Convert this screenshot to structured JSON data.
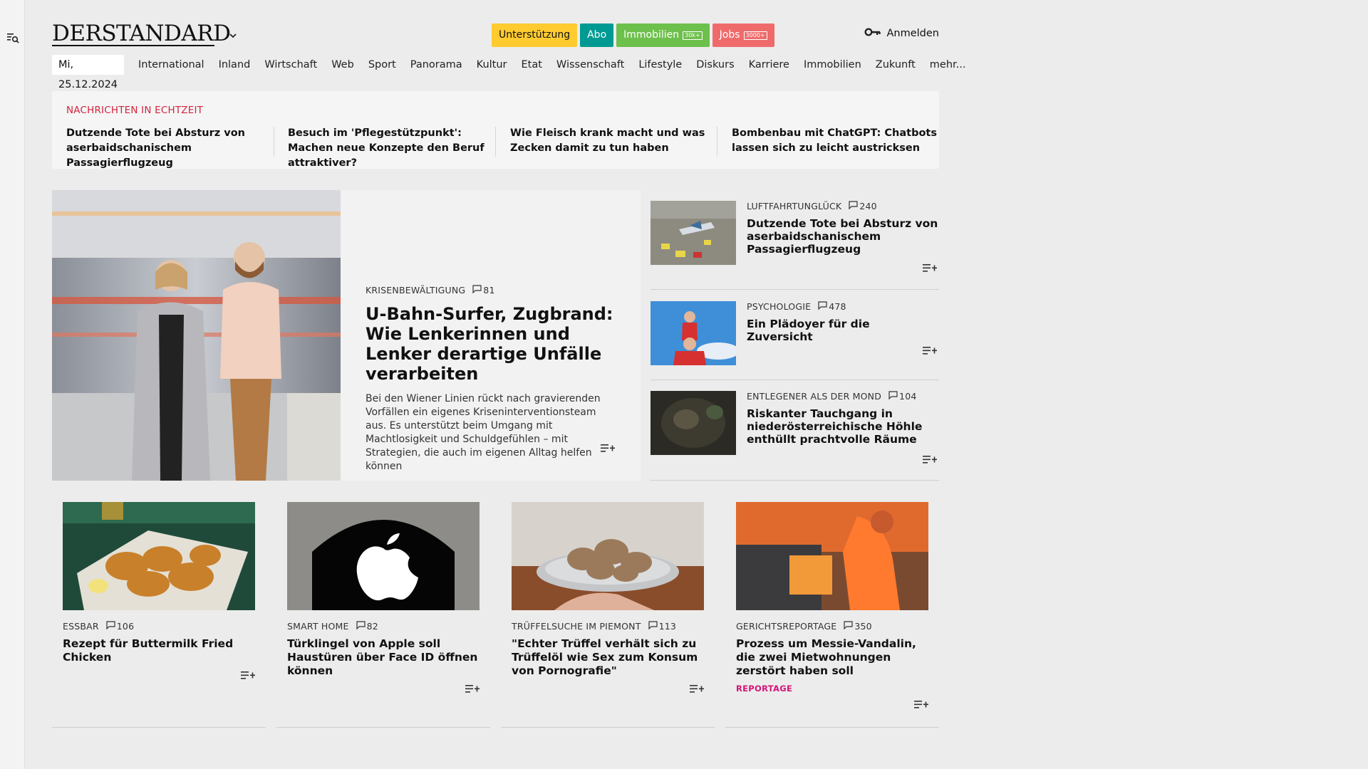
{
  "header": {
    "logo": "DERSTANDARD",
    "pills": [
      {
        "label": "Unterstützung",
        "bg": "#ffcb2f",
        "fg": "#111111",
        "badge": ""
      },
      {
        "label": "Abo",
        "bg": "#009a92",
        "fg": "#ffffff",
        "badge": ""
      },
      {
        "label": "Immobilien",
        "bg": "#6dc04b",
        "fg": "#ffffff",
        "badge": "30k+"
      },
      {
        "label": "Jobs",
        "bg": "#ef6b6b",
        "fg": "#ffffff",
        "badge": "3000+"
      }
    ],
    "login_label": "Anmelden"
  },
  "nav": {
    "date": "Mi, 25.12.2024",
    "items": [
      "International",
      "Inland",
      "Wirtschaft",
      "Web",
      "Sport",
      "Panorama",
      "Kultur",
      "Etat",
      "Wissenschaft",
      "Lifestyle",
      "Diskurs",
      "Karriere",
      "Immobilien",
      "Zukunft",
      "mehr..."
    ]
  },
  "realtime": {
    "label": "NACHRICHTEN IN ECHTZEIT",
    "items": [
      "Dutzende Tote bei Absturz von aser­baidschanischem Passagierflugzeug",
      "Besuch im 'Pflegestützpunkt': Machen neue Konzepte den Beruf attraktiver?",
      "Wie Fleisch krank macht und was Ze­cken damit zu tun haben",
      "Bombenbau mit ChatGPT: Chatbots lassen sich zu leicht austricksen"
    ]
  },
  "hero": {
    "kicker": "KRISENBEWÄLTIGUNG",
    "comments": "81",
    "title": "U-Bahn-Surfer, Zugbrand: Wie Lenkerinnen und Lenker derartige Unfälle verarbeiten",
    "lead": "Bei den Wiener Linien rückt nach gravierenden Vorfällen ein eigenes Kriseninterventionsteam aus. Es unterstützt beim Umgang mit Machtlosigkeit und Schuldgefühlen – mit Strategien, die auch im eigenen Alltag helfen können"
  },
  "side": [
    {
      "kicker": "LUFTFAHRTUNGLÜCK",
      "comments": "240",
      "title": "Dutzende Tote bei Absturz von aserbaidschanischem Passagier­flugzeug"
    },
    {
      "kicker": "PSYCHOLOGIE",
      "comments": "478",
      "title": "Ein Plädoyer für die Zuversicht"
    },
    {
      "kicker": "ENTLEGENER ALS DER MOND",
      "comments": "104",
      "title": "Riskanter Tauchgang in niederös­terreichische Höhle enthüllt prachtvolle Räume"
    }
  ],
  "cards": [
    {
      "kicker": "ESSBAR",
      "comments": "106",
      "title": "Rezept für Buttermilk Fried Chicken",
      "tag": ""
    },
    {
      "kicker": "SMART HOME",
      "comments": "82",
      "title": "Türklingel von Apple soll Haustüren über Face ID öffnen können",
      "tag": ""
    },
    {
      "kicker": "TRÜFFELSUCHE IM PIEMONT",
      "comments": "113",
      "title": "\"Echter Trüffel verhält sich zu Trüffelöl wie Sex zum Konsum von Pornografie\"",
      "tag": ""
    },
    {
      "kicker": "GERICHTSREPORTAGE",
      "comments": "350",
      "title": "Prozess um Messie-Vandalin, die zwei Mietwohnungen zerstört haben soll",
      "tag": "REPORTAGE"
    }
  ]
}
